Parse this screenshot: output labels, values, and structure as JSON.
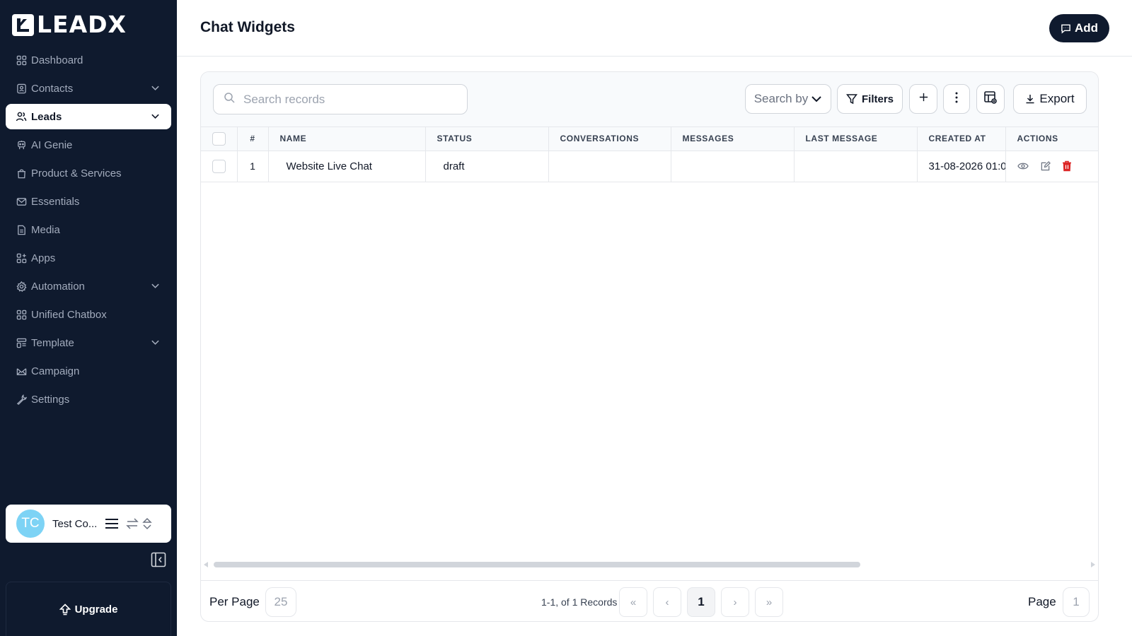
{
  "app": {
    "logo_text": "LEADX"
  },
  "sidebar": {
    "items": [
      {
        "label": "Dashboard",
        "icon": "grid-icon",
        "top": 0
      },
      {
        "label": "Contacts",
        "icon": "contact-card-icon"
      },
      {
        "label": "Leads",
        "icon": "users-icon"
      },
      {
        "label": "AI Genie",
        "icon": "bot-icon"
      },
      {
        "label": "Product & Services",
        "icon": "shopping-bag-icon"
      },
      {
        "label": "Essentials",
        "icon": "mail-icon"
      },
      {
        "label": "Media",
        "icon": "file-icon"
      },
      {
        "label": "Apps",
        "icon": "apps-grid-icon"
      },
      {
        "label": "Automation",
        "icon": "gear-icon"
      },
      {
        "label": "Unified Chatbox",
        "icon": "grid-icon"
      },
      {
        "label": "Template",
        "icon": "template-icon"
      },
      {
        "label": "Campaign",
        "icon": "envelope-open-icon"
      },
      {
        "label": "Settings",
        "icon": "wrench-icon"
      }
    ],
    "profile": {
      "initials": "TC",
      "name": "Test Co..."
    },
    "upgrade_label": "Upgrade"
  },
  "header": {
    "title": "Chat Widgets",
    "add_label": "Add"
  },
  "toolbar": {
    "search_placeholder": "Search records",
    "search_by_label": "Search by",
    "filters_label": "Filters",
    "export_label": "Export"
  },
  "table": {
    "columns": [
      "#",
      "NAME",
      "STATUS",
      "CONVERSATIONS",
      "MESSAGES",
      "LAST MESSAGE",
      "CREATED AT",
      "ACTIONS"
    ],
    "rows": [
      {
        "num": "1",
        "name": "Website Live Chat",
        "status": "draft",
        "conversations": "",
        "messages": "",
        "last_message": "",
        "created_at": "31-08-2026 01:0"
      }
    ]
  },
  "pagination": {
    "per_page_label": "Per Page",
    "per_page_value": "25",
    "records_text": "1-1, of 1 Records",
    "first": "«",
    "prev": "‹",
    "current": "1",
    "next": "›",
    "last": "»",
    "page_label": "Page",
    "page_value": "1"
  },
  "colors": {
    "sidebar_bg": "#0f1a2e",
    "accent": "#0f1a2e",
    "danger": "#dc2626",
    "avatar": "#7dd3f5"
  }
}
